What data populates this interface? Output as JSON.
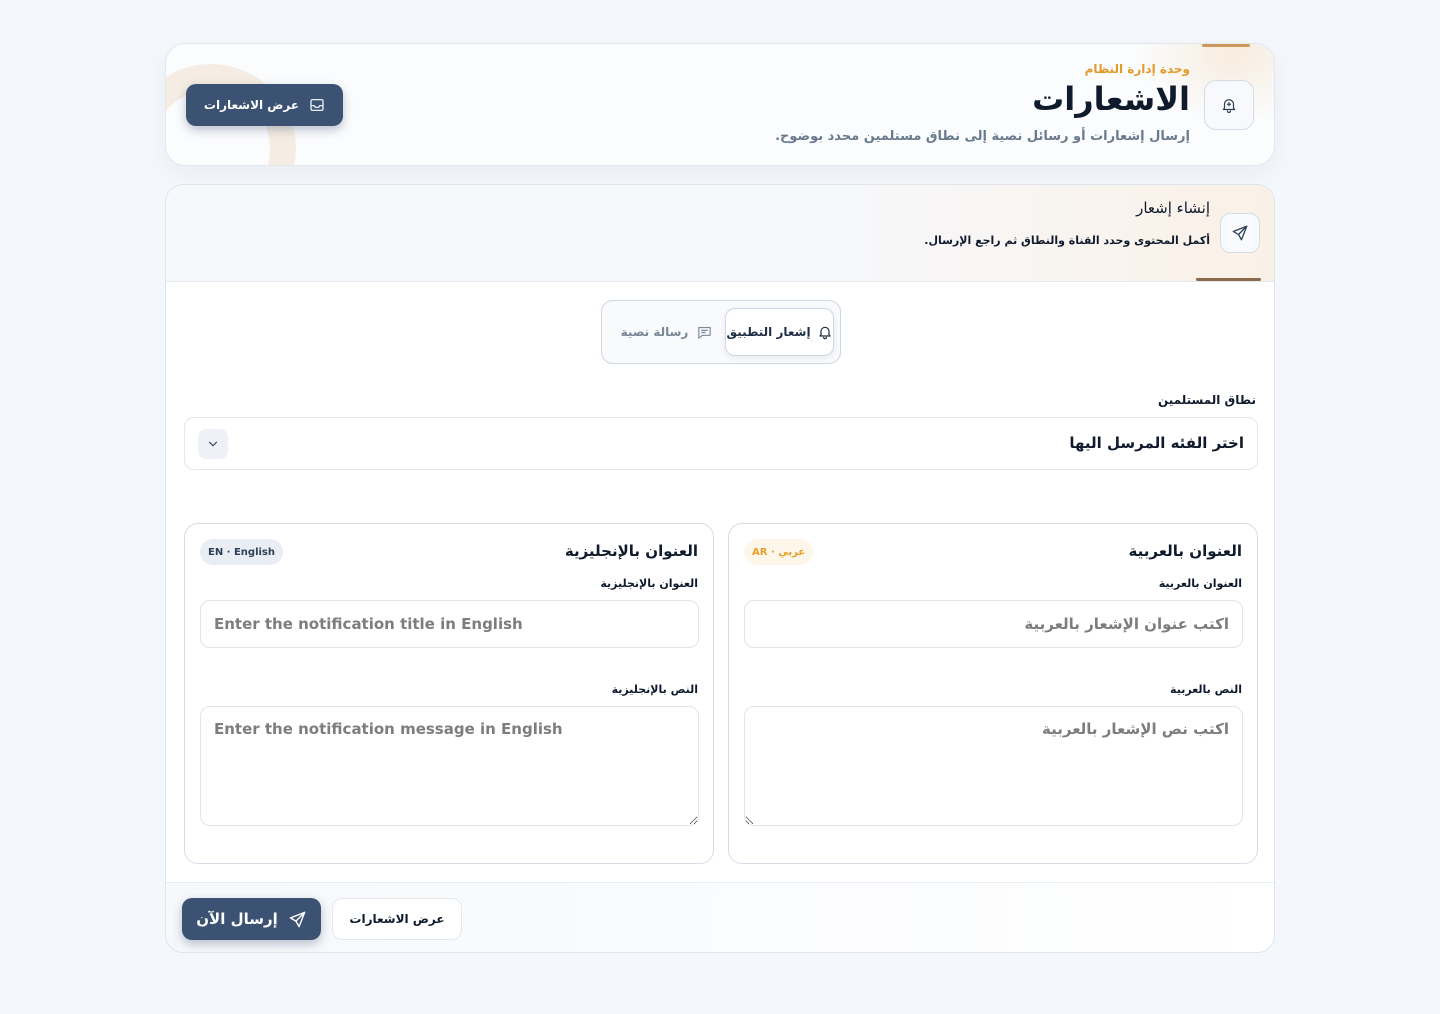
{
  "header": {
    "eyebrow": "وحدة إدارة النظام",
    "title": "الاشعارات",
    "subtitle": "إرسال إشعارات أو رسائل نصية إلى نطاق مستلمين محدد بوضوح.",
    "view_button": "عرض الاشعارات"
  },
  "compose": {
    "title": "إنشاء إشعار",
    "subtitle": "أكمل المحتوى وحدد القناة والنطاق ثم راجع الإرسال."
  },
  "tabs": {
    "app_notification": "إشعار التطبيق",
    "sms": "رسالة نصية"
  },
  "scope": {
    "label": "نطاق المستلمين",
    "value": "اختر الفئه المرسل اليها"
  },
  "arabic": {
    "card_title": "العنوان بالعربية",
    "badge": "AR · عربي",
    "title_label": "العنوان بالعربية",
    "title_placeholder": "اكتب عنوان الإشعار بالعربية",
    "body_label": "النص بالعربية",
    "body_placeholder": "اكتب نص الإشعار بالعربية"
  },
  "english": {
    "card_title": "العنوان بالإنجليزية",
    "badge": "EN · English",
    "title_label": "العنوان بالإنجليزية",
    "title_placeholder": "Enter the notification title in English",
    "body_label": "النص بالإنجليزية",
    "body_placeholder": "Enter the notification message in English"
  },
  "footer": {
    "send_now": "إرسال الآن",
    "view_button": "عرض الاشعارات"
  },
  "colors": {
    "primary": "#3c5273",
    "accent": "#e29a2b",
    "background": "#f4f7fb"
  }
}
